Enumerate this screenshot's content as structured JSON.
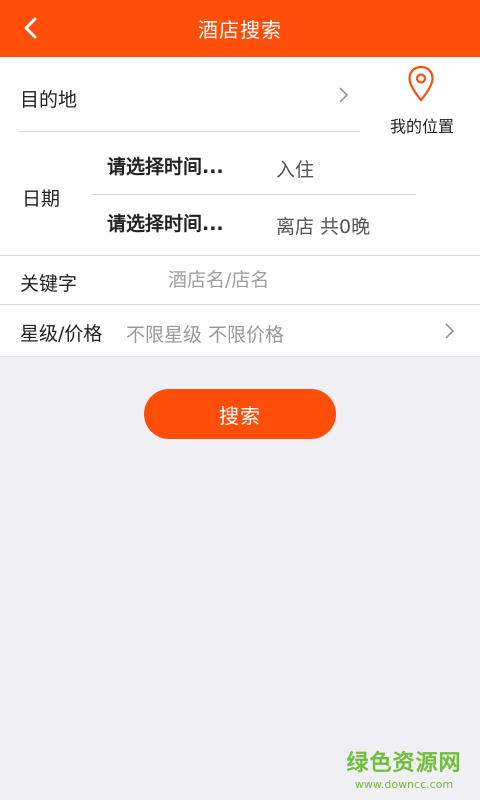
{
  "header": {
    "title": "酒店搜索",
    "back_icon": "chevron-left-icon"
  },
  "form": {
    "destination": {
      "label": "目的地"
    },
    "my_location": {
      "label": "我的位置",
      "icon": "location-pin-icon",
      "icon_color": "#ff4e0a"
    },
    "date": {
      "label": "日期",
      "checkin": {
        "value": "请选择时间...",
        "suffix": "入住"
      },
      "checkout": {
        "value": "请选择时间...",
        "suffix": "离店 共0晚"
      }
    },
    "keyword": {
      "label": "关键字",
      "placeholder": "酒店名/店名"
    },
    "star_price": {
      "label": "星级/价格",
      "value": "不限星级 不限价格"
    }
  },
  "search_button": {
    "label": "搜索"
  },
  "watermark": {
    "title": "绿色资源网",
    "url": "www.downcc.com"
  },
  "colors": {
    "accent": "#ff4e0a",
    "background": "#efeff4"
  }
}
